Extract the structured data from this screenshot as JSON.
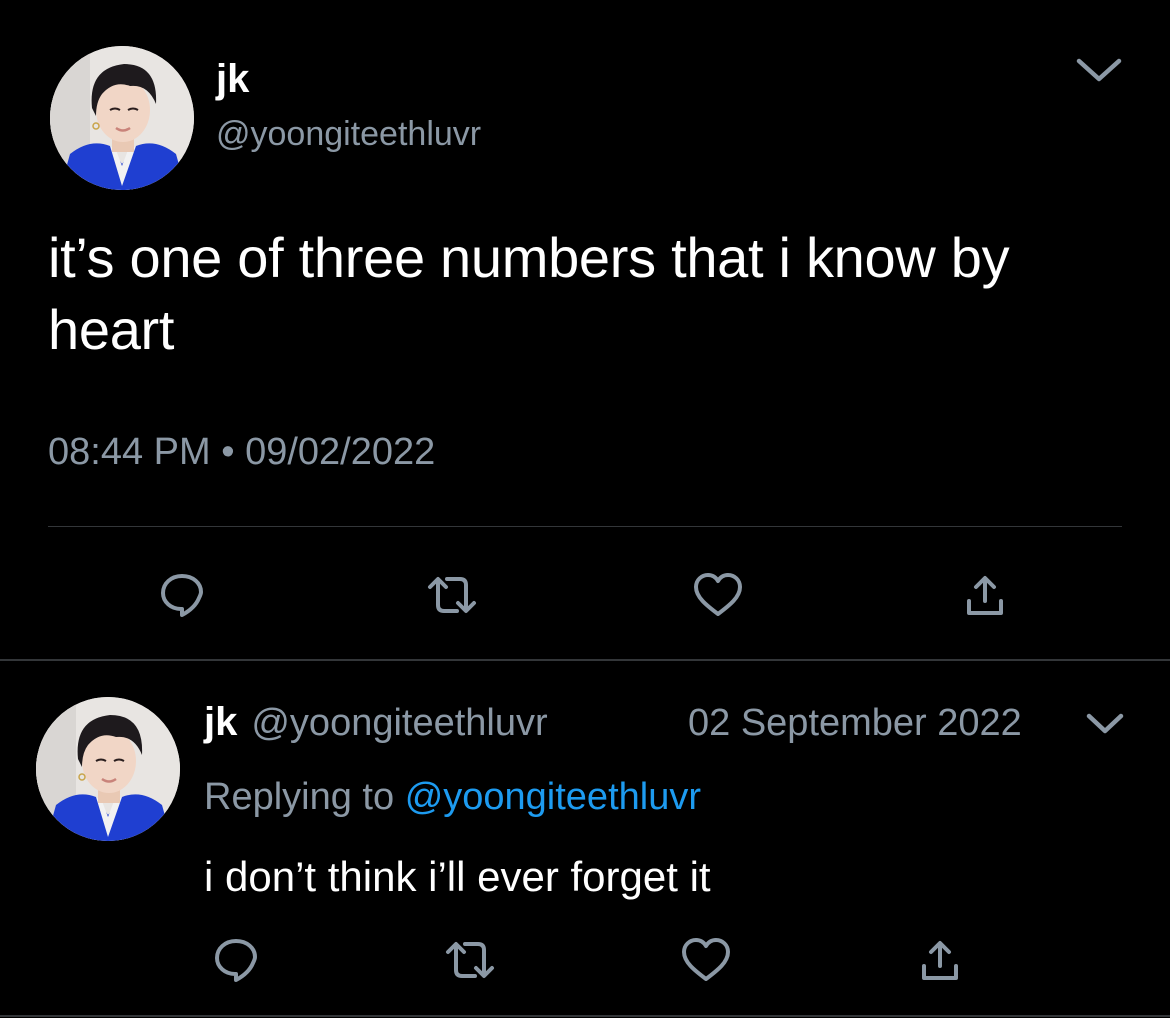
{
  "main_tweet": {
    "author_name": "jk",
    "author_handle": "@yoongiteethluvr",
    "text": "it’s one of three numbers that i know by heart",
    "timestamp": "08:44 PM",
    "separator": "•",
    "date": "09/02/2022",
    "actions": [
      {
        "name": "reply",
        "icon": "reply-icon"
      },
      {
        "name": "retweet",
        "icon": "retweet-icon"
      },
      {
        "name": "like",
        "icon": "heart-icon"
      },
      {
        "name": "share",
        "icon": "share-icon"
      }
    ]
  },
  "reply_tweet": {
    "author_name": "jk",
    "author_handle": "@yoongiteethluvr",
    "date": "02 September 2022",
    "replying_prefix": "Replying to",
    "replying_handle": "@yoongiteethluvr",
    "text": "i don’t think i’ll ever forget it",
    "actions": [
      {
        "name": "reply",
        "icon": "reply-icon"
      },
      {
        "name": "retweet",
        "icon": "retweet-icon"
      },
      {
        "name": "like",
        "icon": "heart-icon"
      },
      {
        "name": "share",
        "icon": "share-icon"
      }
    ]
  },
  "colors": {
    "background": "#000000",
    "text_primary": "#ffffff",
    "text_secondary": "#8b98a5",
    "link": "#1d9bf0",
    "divider": "#333639"
  }
}
